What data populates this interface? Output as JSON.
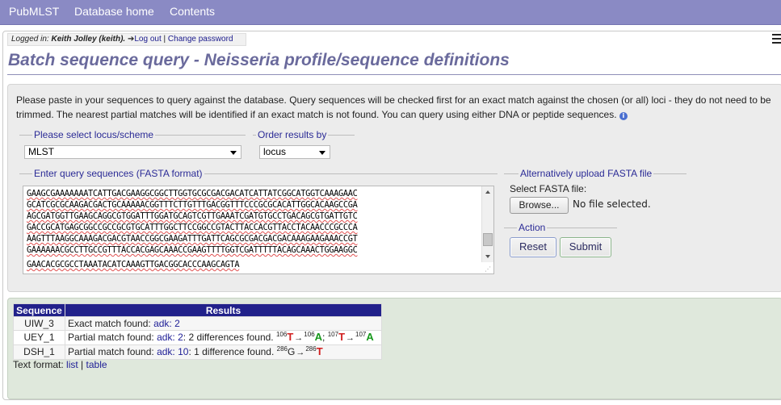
{
  "topnav": {
    "items": [
      "PubMLST",
      "Database home",
      "Contents"
    ]
  },
  "login": {
    "prefix": "Logged in:",
    "user": "Keith Jolley (keith).",
    "logout": "Log out",
    "separator": "|",
    "change_password": "Change password"
  },
  "page_title": "Batch sequence query - Neisseria profile/sequence definitions",
  "intro_text": "Please paste in your sequences to query against the database. Query sequences will be checked first for an exact match against the chosen (or all) loci - they do not need to be trimmed. The nearest partial matches will be identified if an exact match is not found. You can query using either DNA or peptide sequences.",
  "locus_fieldset": {
    "legend": "Please select locus/scheme",
    "selected": "MLST"
  },
  "order_fieldset": {
    "legend": "Order results by",
    "selected": "locus"
  },
  "query_fieldset": {
    "legend": "Enter query sequences (FASTA format)",
    "lines": [
      "GAAGCGAAAAAAATCATTGACGAAGGCGGCTTGGTGCGCGACGACATCATTATCGGCATGGTCAAAGAAC",
      "GCATCGCGCAAGACGACTGCAAAAACGGTTTCTTGTTTGACGGTTTCCCGCGCACATTGGCACAAGCCGA",
      "AGCGATGGTTGAAGCAGGCGTGGATTTGGATGCAGTCGTTGAAATCGATGTGCCTGACAGCGTGATTGTC",
      "GACCGCATGAGCGGCCGCCGCGTGCATTTGGCTTCCGGCCGTACTTACCACGTTACCTACAACCCGCCCA",
      "AAGTTTAAGGCAAAGACGACGTAACCGGCGAAGATTTGATTCAGCGCGACGACGACAAAGAAGAAACCGT",
      "GAAAAAACGCCTTGCCGTTTACCACGAGCAAACCGAAGTTTTGGTCGATTTTTACAGCAAACTGGAAGGC",
      "GAACACGCGCCTAAATACATCAAAGTTGACGGCACCCAAGCAGTA"
    ]
  },
  "upload_fieldset": {
    "legend": "Alternatively upload FASTA file",
    "label": "Select FASTA file:",
    "browse": "Browse...",
    "status": "No file selected."
  },
  "action_fieldset": {
    "legend": "Action",
    "reset": "Reset",
    "submit": "Submit"
  },
  "results": {
    "headers": [
      "Sequence",
      "Results"
    ],
    "rows": [
      {
        "sequence": "UIW_3",
        "prefix": "Exact match found:",
        "allele": "adk: 2"
      },
      {
        "sequence": "UEY_1",
        "prefix": "Partial match found:",
        "allele": "adk: 2",
        "diff": ": 2 differences found.",
        "changes": [
          {
            "pos_from": "106",
            "from": "T",
            "pos_to": "106",
            "to": "A"
          },
          {
            "pos_from": "107",
            "from": "T",
            "pos_to": "107",
            "to": "A"
          }
        ]
      },
      {
        "sequence": "DSH_1",
        "prefix": "Partial match found:",
        "allele": "adk: 10",
        "diff": ": 1 difference found.",
        "changes": [
          {
            "pos_from": "286",
            "from": "G",
            "pos_to": "286",
            "to": "T"
          }
        ]
      }
    ],
    "text_format": {
      "label": "Text format:",
      "list": "list",
      "sep": "|",
      "table": "table"
    }
  },
  "colors": {
    "nav_bg": "#8a8ac4",
    "title": "#6a6a9c",
    "table_header": "#21218a",
    "base_changed": "#d11f1f",
    "base_target": "#16981b",
    "results_bg": "#dfe8dc"
  }
}
